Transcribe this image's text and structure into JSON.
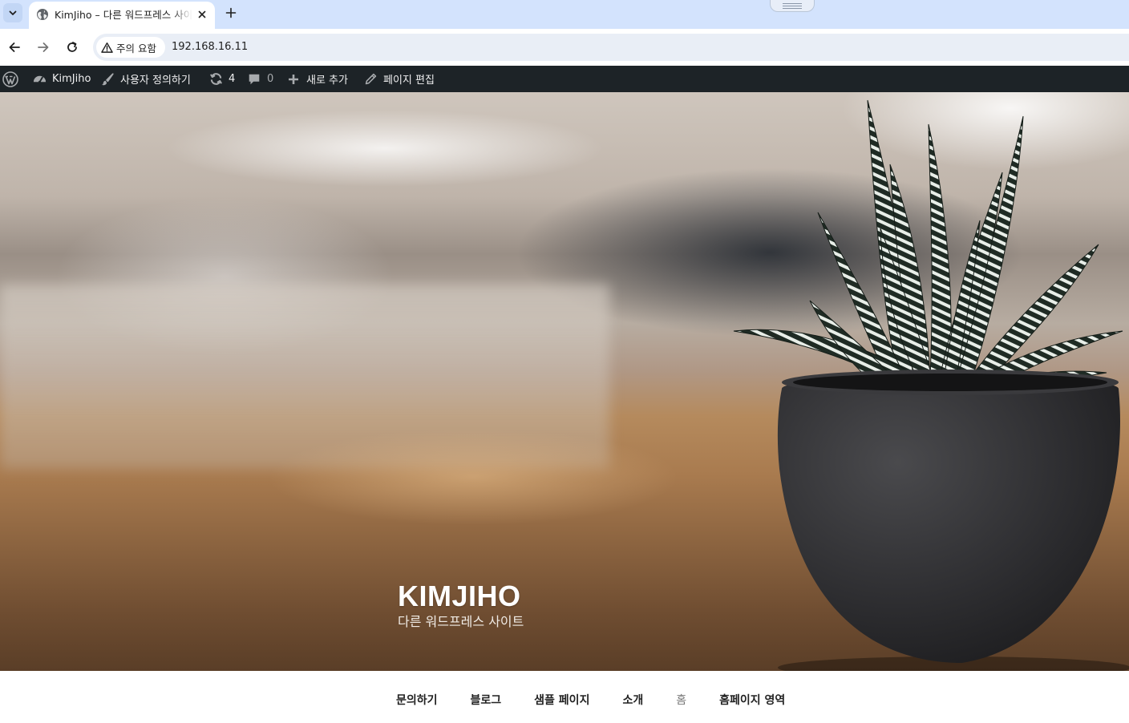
{
  "browser": {
    "tab": {
      "title": "KimJiho – 다른 워드프레스 사이트",
      "favicon": "globe-icon"
    },
    "new_tab_icon": "plus-icon",
    "tab_search_icon": "chevron-down-icon",
    "toolbar": {
      "back_icon": "arrow-left-icon",
      "forward_icon": "arrow-right-icon",
      "reload_icon": "reload-icon",
      "security_label": "주의 요함",
      "url": "192.168.16.11"
    }
  },
  "admin_bar": {
    "wp_logo_icon": "wordpress-logo-icon",
    "site_name": "KimJiho",
    "customize": "사용자 정의하기",
    "updates_count": "4",
    "comments_count": "0",
    "new_content": "새로 추가",
    "edit_page": "페이지 편집",
    "colors": {
      "background": "#1d2327",
      "text": "#f0f0f1"
    }
  },
  "hero": {
    "site_title": "KIMJIHO",
    "site_description": "다른 워드프레스 사이트"
  },
  "navigation": {
    "items": [
      {
        "label": "문의하기",
        "current": false
      },
      {
        "label": "블로그",
        "current": false
      },
      {
        "label": "샘플 페이지",
        "current": false
      },
      {
        "label": "소개",
        "current": false
      },
      {
        "label": "홈",
        "current": true
      },
      {
        "label": "홈페이지 영역",
        "current": false
      }
    ]
  }
}
